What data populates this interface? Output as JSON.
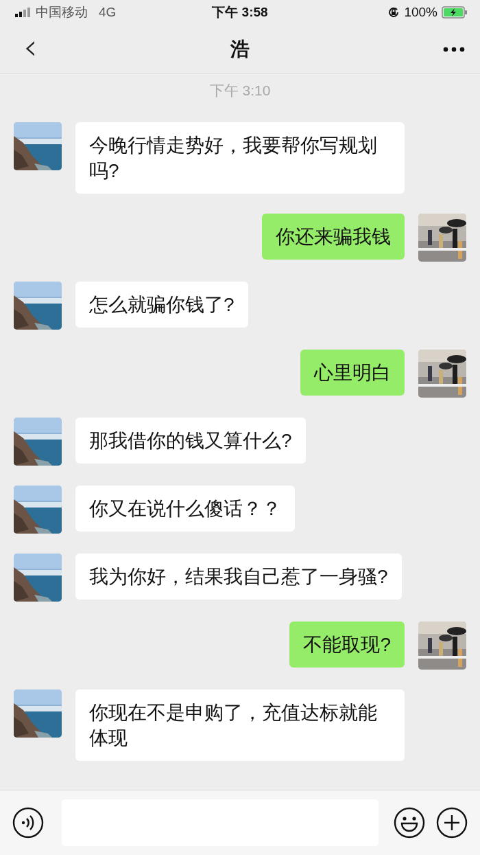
{
  "status_bar": {
    "carrier": "中国移动",
    "network": "4G",
    "time": "下午 3:58",
    "battery": "100%"
  },
  "nav": {
    "back": "‹",
    "title": "浩"
  },
  "timestamp": "下午 3:10",
  "messages": [
    {
      "kind": "received",
      "text": "今晚行情走势好，我要帮你写规划吗?"
    },
    {
      "kind": "sent",
      "text": "你还来骗我钱"
    },
    {
      "kind": "received",
      "text": "怎么就骗你钱了?"
    },
    {
      "kind": "sent",
      "text": "心里明白"
    },
    {
      "kind": "received",
      "text": "那我借你的钱又算什么?"
    },
    {
      "kind": "received",
      "text": "你又在说什么傻话？？"
    },
    {
      "kind": "received",
      "text": "我为你好，结果我自己惹了一身骚?"
    },
    {
      "kind": "sent",
      "text": "不能取现?"
    },
    {
      "kind": "received",
      "text": "你现在不是申购了，充值达标就能体现"
    }
  ]
}
